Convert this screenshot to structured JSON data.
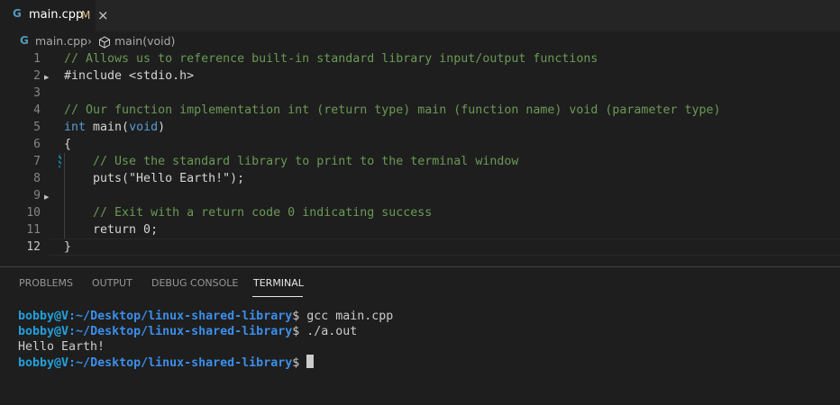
{
  "tab": {
    "icon": "cpp-file-icon",
    "label": "main.cpp",
    "modified": "M",
    "icon_color": "#519aba",
    "modified_color": "#e2c08d"
  },
  "breadcrumb": {
    "file": "main.cpp",
    "symbol": "main(void)"
  },
  "editor": {
    "lines": [
      {
        "number": "1",
        "tokens": [
          {
            "text": "// Allows us to reference built-in standard library input/output functions",
            "type": "comment"
          }
        ]
      },
      {
        "number": "2",
        "tokens": [
          {
            "text": "#include <stdio.h>",
            "type": "plain"
          }
        ]
      },
      {
        "number": "3",
        "tokens": []
      },
      {
        "number": "4",
        "tokens": [
          {
            "text": "// Our function implementation int (return type) main (function name) void (parameter type)",
            "type": "comment"
          }
        ]
      },
      {
        "number": "5",
        "tokens": [
          {
            "text": "int",
            "type": "kw"
          },
          {
            "text": " main(",
            "type": "plain"
          },
          {
            "text": "void",
            "type": "kw"
          },
          {
            "text": ")",
            "type": "plain"
          }
        ]
      },
      {
        "number": "6",
        "tokens": [
          {
            "text": "{",
            "type": "plain"
          }
        ]
      },
      {
        "number": "7",
        "tokens": [
          {
            "text": "    ",
            "type": "plain"
          },
          {
            "text": "// Use the standard library to print to the terminal window",
            "type": "comment"
          }
        ]
      },
      {
        "number": "8",
        "tokens": [
          {
            "text": "    puts(\"Hello Earth!\");",
            "type": "plain"
          }
        ]
      },
      {
        "number": "9",
        "tokens": []
      },
      {
        "number": "10",
        "tokens": [
          {
            "text": "    ",
            "type": "plain"
          },
          {
            "text": "// Exit with a return code 0 indicating success",
            "type": "comment"
          }
        ]
      },
      {
        "number": "11",
        "tokens": [
          {
            "text": "    return 0;",
            "type": "plain"
          }
        ]
      },
      {
        "number": "12",
        "tokens": [
          {
            "text": "}",
            "type": "plain"
          }
        ]
      }
    ],
    "active_line": "12"
  },
  "panel": {
    "tabs": [
      "PROBLEMS",
      "OUTPUT",
      "DEBUG CONSOLE",
      "TERMINAL"
    ],
    "active_tab": "TERMINAL"
  },
  "terminal": {
    "lines": [
      {
        "prompt_user": "bobby@V",
        "prompt_path": ":~/Desktop/linux-shared-library",
        "command": "$ gcc main.cpp"
      },
      {
        "prompt_user": "bobby@V",
        "prompt_path": ":~/Desktop/linux-shared-library",
        "command": "$ ./a.out"
      },
      {
        "output": "Hello Earth!"
      },
      {
        "prompt_user": "bobby@V",
        "prompt_path": ":~/Desktop/linux-shared-library",
        "command": "$ ",
        "cursor": true
      }
    ]
  }
}
